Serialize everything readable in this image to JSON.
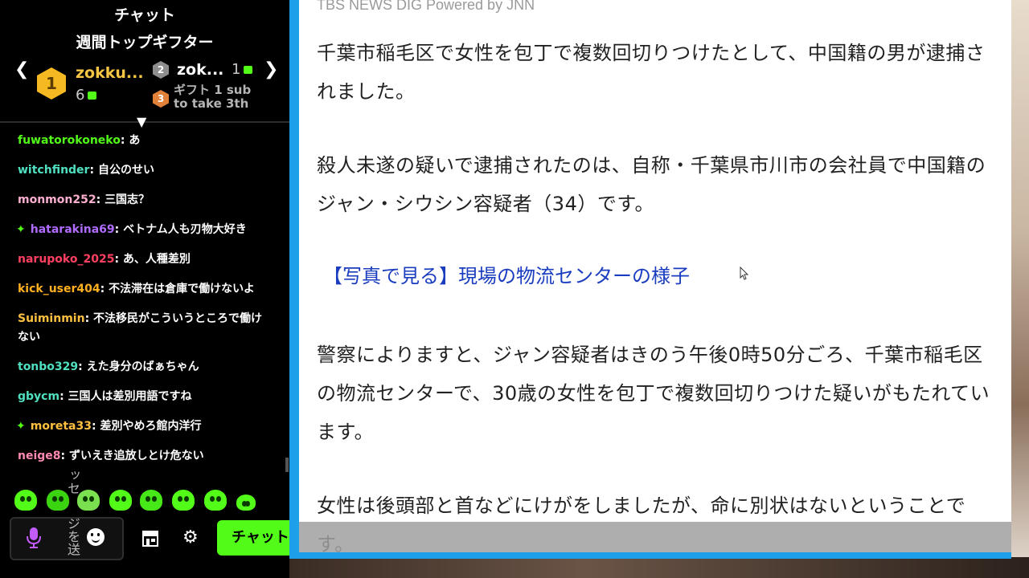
{
  "chat": {
    "title": "チャット",
    "gifters_title": "週間トップギフター",
    "gifter1": {
      "rank": "1",
      "name": "zokku...",
      "count": "6"
    },
    "gifter2": {
      "rank": "2",
      "name": "zok...",
      "count": "1"
    },
    "gifter3": {
      "rank": "3",
      "line1": "ギフト 1 sub",
      "line2": "to take 3th"
    },
    "messages": [
      {
        "user": "fuwatorokoneko",
        "color": "#53fc18",
        "text": "あ",
        "badge": false
      },
      {
        "user": "witchfinder",
        "color": "#4fe0c0",
        "text": "自公のせい",
        "badge": false
      },
      {
        "user": "monmon252",
        "color": "#ffb0d0",
        "text": "三国志？",
        "badge": false
      },
      {
        "user": "hatarakina69",
        "color": "#b06bff",
        "text": "ベトナム人も刃物大好き",
        "badge": true
      },
      {
        "user": "narupoko_2025",
        "color": "#ff4060",
        "text": "あ、人種差別",
        "badge": false
      },
      {
        "user": "kick_user404",
        "color": "#ffb020",
        "text": "不法滞在は倉庫で働けないよ",
        "badge": false
      },
      {
        "user": "Suiminmin",
        "color": "#ffc040",
        "text": "不法移民がこういうところで働けない",
        "badge": false
      },
      {
        "user": "tonbo329",
        "color": "#4fe0c0",
        "text": "えた身分のばぁちゃん",
        "badge": false
      },
      {
        "user": "gbycm",
        "color": "#4fe0c0",
        "text": "三国人は差別用語ですね",
        "badge": false
      },
      {
        "user": "moreta33",
        "color": "#ffc040",
        "text": "差別やめろ館内洋行",
        "badge": true
      },
      {
        "user": "neige8",
        "color": "#ff8ab0",
        "text": "ずいえき追放しとけ危ない",
        "badge": false
      }
    ],
    "emote_overlay": "ッセ",
    "input_overlay": "ジを送",
    "send_label": "チャット",
    "icons": [
      "mic-icon",
      "smile-icon",
      "store-icon",
      "gear-icon"
    ],
    "accent": "#53fc18"
  },
  "article": {
    "source": "TBS NEWS DIG Powered by JNN",
    "p1": "千葉市稲毛区で女性を包丁で複数回切りつけたとして、中国籍の男が逮捕されました。",
    "p2": "殺人未遂の疑いで逮捕されたのは、自称・千葉県市川市の会社員で中国籍のジャン・シウシン容疑者（34）です。",
    "link": "【写真で見る】現場の物流センターの様子",
    "p4": "警察によりますと、ジャン容疑者はきのう午後0時50分ごろ、千葉市稲毛区の物流センターで、30歳の女性を包丁で複数回切りつけた疑いがもたれています。",
    "p5": "女性は後頭部と首などにけがをしましたが、命に別状はないということです。",
    "frame_color": "#1ea0e8",
    "link_color": "#1a3dbf"
  }
}
